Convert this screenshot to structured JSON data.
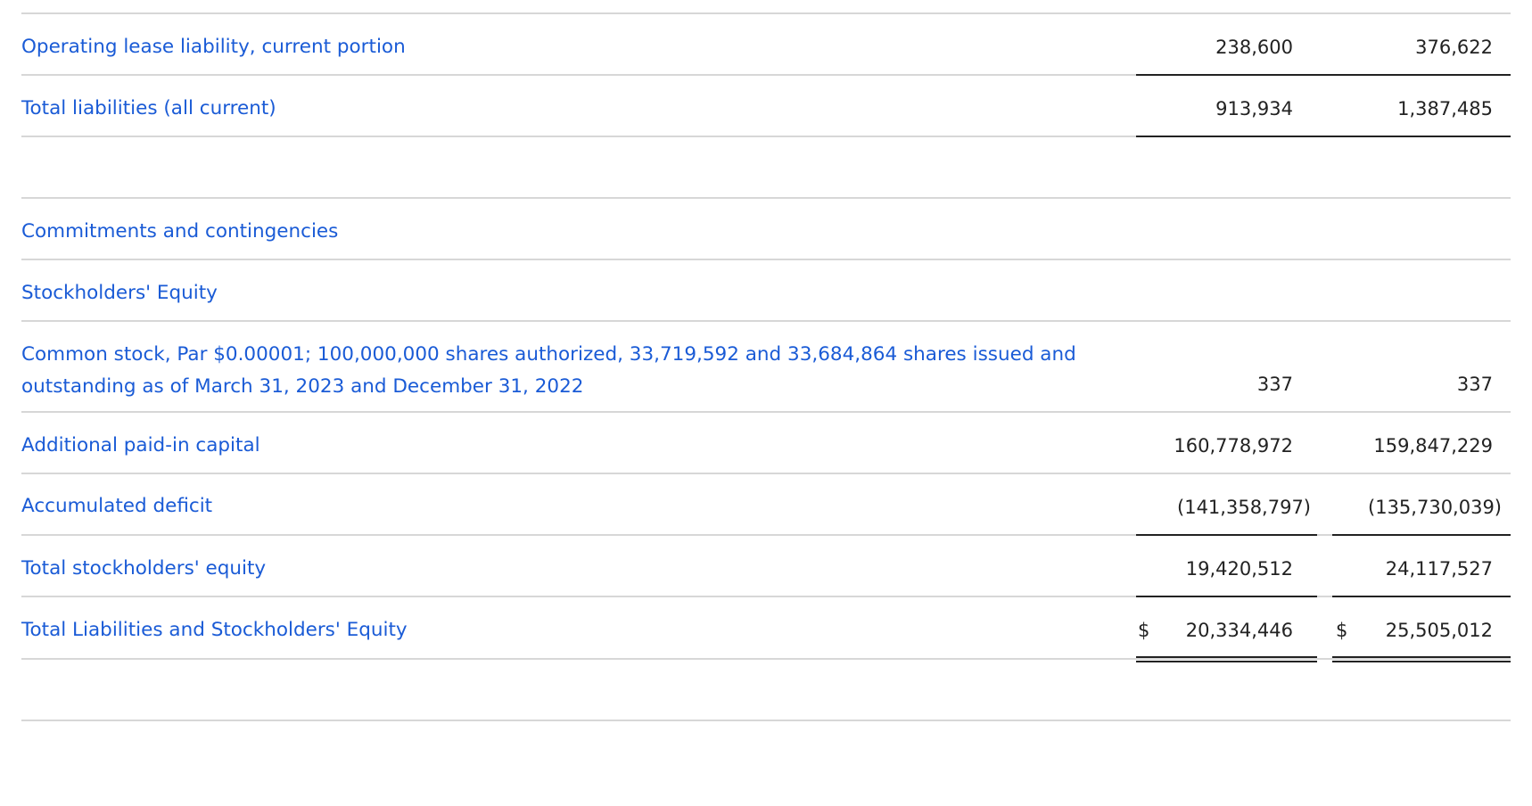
{
  "rows": {
    "oll": {
      "label": "Operating lease liability, current portion",
      "v1": "238,600",
      "v2": "376,622"
    },
    "tl": {
      "label": "Total liabilities (all current)",
      "v1": "913,934",
      "v2": "1,387,485"
    },
    "cc": {
      "label": "Commitments and contingencies"
    },
    "se": {
      "label": "Stockholders' Equity"
    },
    "cs": {
      "line1": "Common stock, Par $0.00001; 100,000,000 shares authorized, 33,719,592 and 33,684,864 shares issued and",
      "line2": "outstanding as of March 31, 2023 and December 31, 2022",
      "v1": "337",
      "v2": "337"
    },
    "apic": {
      "label": "Additional paid-in capital",
      "v1": "160,778,972",
      "v2": "159,847,229"
    },
    "ad": {
      "label": "Accumulated deficit",
      "v1": "(141,358,797)",
      "v2": "(135,730,039)"
    },
    "tse": {
      "label": "Total stockholders' equity",
      "v1": "19,420,512",
      "v2": "24,117,527"
    },
    "tlse": {
      "label": "Total Liabilities and Stockholders' Equity",
      "cur1": "$",
      "v1": "20,334,446",
      "cur2": "$",
      "v2": "25,505,012"
    }
  }
}
